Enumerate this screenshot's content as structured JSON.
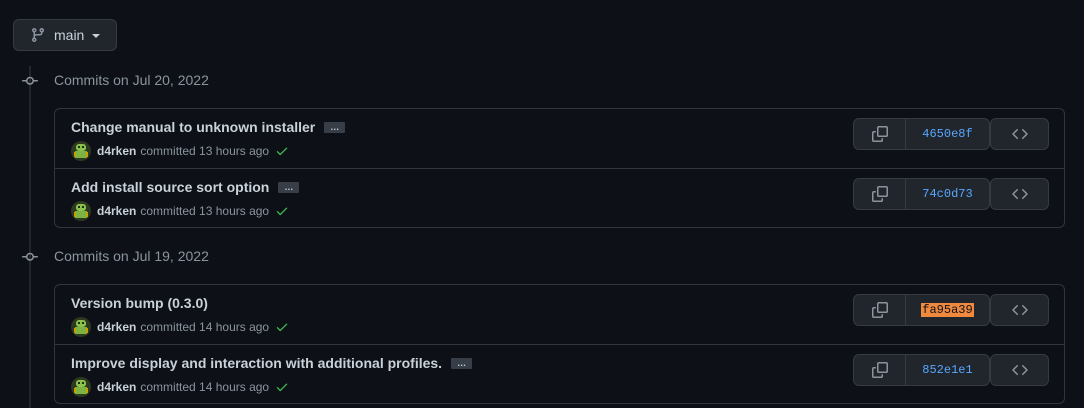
{
  "branch": {
    "name": "main",
    "icon": "git-branch-icon"
  },
  "groups": [
    {
      "title": "Commits on Jul 20, 2022",
      "commits": [
        {
          "title": "Change manual to unknown installer",
          "has_ellipsis": true,
          "author": "d4rken",
          "action": "committed 13 hours ago",
          "status": "success",
          "sha": "4650e8f",
          "sha_highlight": false
        },
        {
          "title": "Add install source sort option",
          "has_ellipsis": true,
          "author": "d4rken",
          "action": "committed 13 hours ago",
          "status": "success",
          "sha": "74c0d73",
          "sha_highlight": false
        }
      ]
    },
    {
      "title": "Commits on Jul 19, 2022",
      "commits": [
        {
          "title": "Version bump (0.3.0)",
          "has_ellipsis": false,
          "author": "d4rken",
          "action": "committed 14 hours ago",
          "status": "success",
          "sha": "fa95a39",
          "sha_highlight": true
        },
        {
          "title": "Improve display and interaction with additional profiles.",
          "has_ellipsis": true,
          "author": "d4rken",
          "action": "committed 14 hours ago",
          "status": "success",
          "sha": "852e1e1",
          "sha_highlight": false
        }
      ]
    }
  ],
  "ellipsis_label": "…",
  "colors": {
    "sha_link": "#58a6ff",
    "success": "#3fb950",
    "highlight": "#f0883e"
  }
}
